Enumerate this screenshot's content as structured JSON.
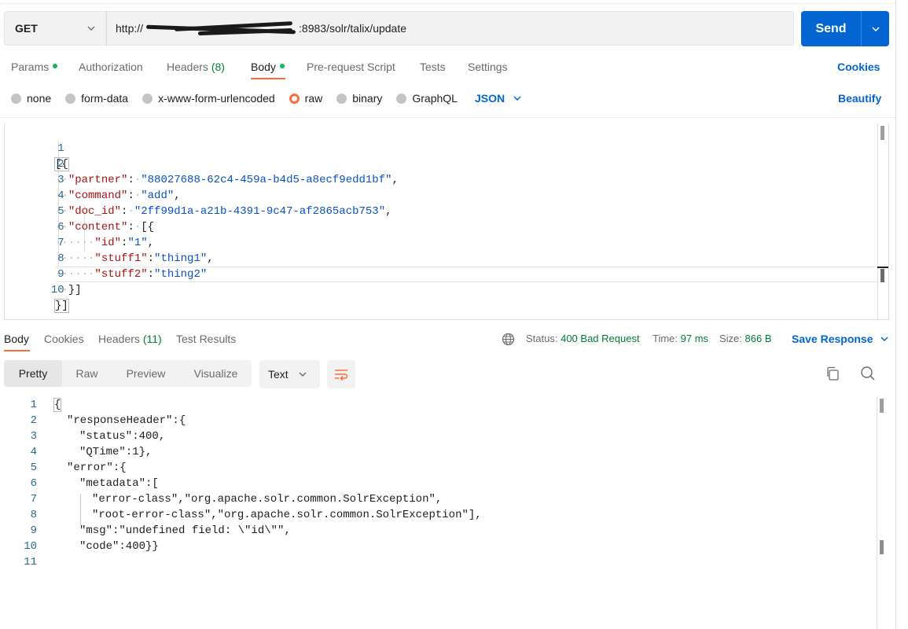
{
  "request": {
    "method": "GET",
    "url_prefix": "http://",
    "url_suffix": ":8983/solr/talix/update",
    "send_label": "Send"
  },
  "request_tabs": {
    "params": "Params",
    "authorization": "Authorization",
    "headers": "Headers",
    "headers_count": "(8)",
    "body": "Body",
    "prerequest": "Pre-request Script",
    "tests": "Tests",
    "settings": "Settings",
    "cookies": "Cookies"
  },
  "body_types": {
    "none": "none",
    "form_data": "form-data",
    "urlencoded": "x-www-form-urlencoded",
    "raw": "raw",
    "binary": "binary",
    "graphql": "GraphQL",
    "selected_language": "JSON",
    "beautify": "Beautify"
  },
  "request_body": {
    "line_numbers": [
      "1",
      "2",
      "3",
      "4",
      "5",
      "6",
      "7",
      "8",
      "9",
      "10"
    ],
    "l1_open": "[{",
    "l2_key": "\"partner\"",
    "l2_val": "\"88027688-62c4-459a-b4d5-a8ecf9edd1bf\"",
    "l3_key": "\"command\"",
    "l3_val": "\"add\"",
    "l4_key": "\"doc_id\"",
    "l4_val": "\"2ff99d1a-a21b-4391-9c47-af2865acb753\"",
    "l5_key": "\"content\"",
    "l5_open": "[{",
    "l6_key": "\"id\"",
    "l6_val": "\"1\"",
    "l7_key": "\"stuff1\"",
    "l7_val": "\"thing1\"",
    "l8_key": "\"stuff2\"",
    "l8_val": "\"thing2\"",
    "l9_close": "}]",
    "l10_close": "}]"
  },
  "response_tabs": {
    "body": "Body",
    "cookies": "Cookies",
    "headers": "Headers",
    "headers_count": "(11)",
    "test_results": "Test Results"
  },
  "response_status": {
    "status_label": "Status:",
    "status_value": "400 Bad Request",
    "time_label": "Time:",
    "time_value": "97 ms",
    "size_label": "Size:",
    "size_value": "866 B",
    "save_response": "Save Response"
  },
  "response_view": {
    "pretty": "Pretty",
    "raw": "Raw",
    "preview": "Preview",
    "visualize": "Visualize",
    "format": "Text"
  },
  "response_body": {
    "line_numbers": [
      "1",
      "2",
      "3",
      "4",
      "5",
      "6",
      "7",
      "8",
      "9",
      "10",
      "11"
    ],
    "l1": "{",
    "l2": "\"responseHeader\":{",
    "l3": "\"status\":400,",
    "l4": "\"QTime\":1},",
    "l5": "\"error\":{",
    "l6": "\"metadata\":[",
    "l7": "\"error-class\",\"org.apache.solr.common.SolrException\",",
    "l8": "\"root-error-class\",\"org.apache.solr.common.SolrException\"],",
    "l9": "\"msg\":\"undefined field: \\\"id\\\"\",",
    "l10": "\"code\":400}}"
  },
  "colors": {
    "accent_blue": "#0265d2",
    "tab_orange": "#ff6c37",
    "success_green": "#0cbb52",
    "status_green": "#007f31",
    "json_key": "#a31515",
    "json_string": "#0b51c1"
  }
}
